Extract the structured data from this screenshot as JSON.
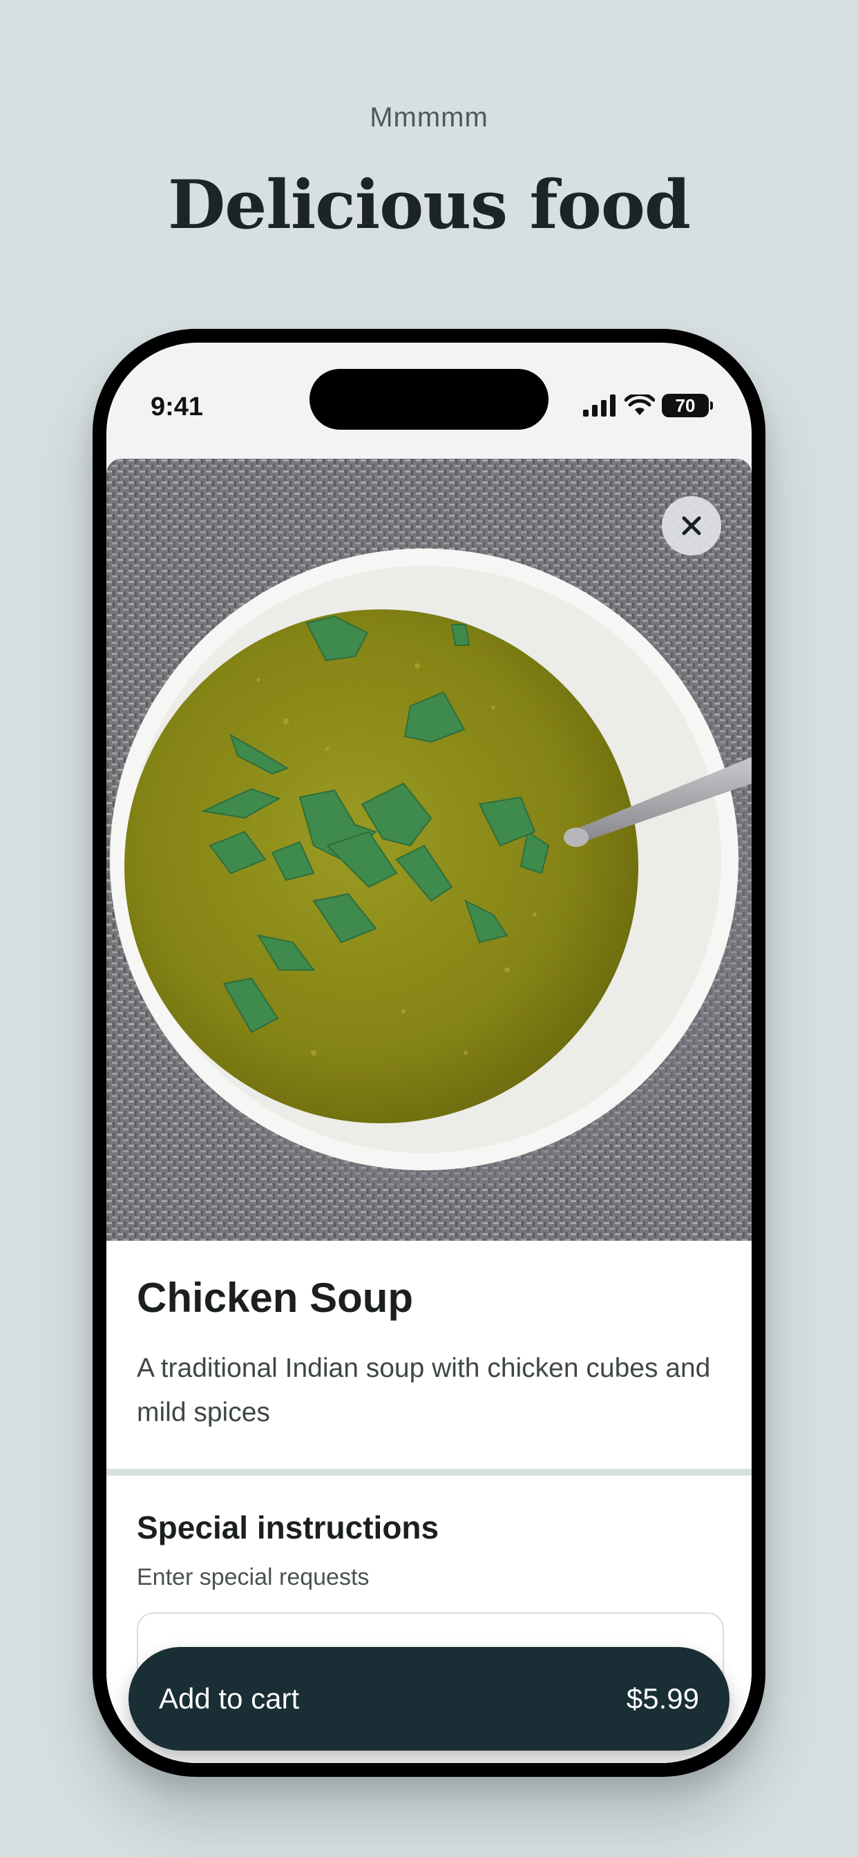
{
  "promo": {
    "eyebrow": "Mmmmm",
    "headline": "Delicious food"
  },
  "status_bar": {
    "time": "9:41",
    "battery": "70"
  },
  "item": {
    "image_icon": "soup-bowl-photo",
    "name": "Chicken Soup",
    "description": "A traditional Indian soup with chicken cubes and mild spices"
  },
  "instructions": {
    "title": "Special instructions",
    "subtitle": "Enter special requests",
    "value": ""
  },
  "cart": {
    "label": "Add to cart",
    "price": "$5.99"
  },
  "colors": {
    "background": "#d7dfe1",
    "button": "#1a2e36",
    "divider": "#d6e0e1"
  }
}
